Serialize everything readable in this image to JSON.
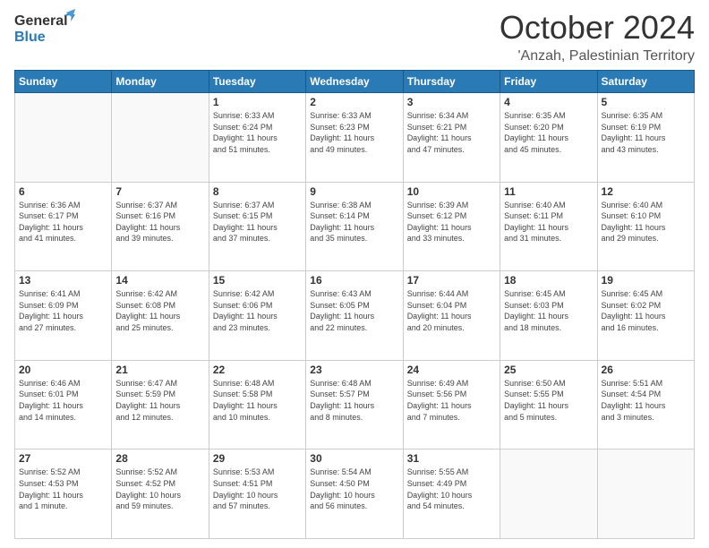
{
  "header": {
    "logo": {
      "general": "General",
      "blue": "Blue"
    },
    "month": "October 2024",
    "location": "'Anzah, Palestinian Territory"
  },
  "weekdays": [
    "Sunday",
    "Monday",
    "Tuesday",
    "Wednesday",
    "Thursday",
    "Friday",
    "Saturday"
  ],
  "weeks": [
    [
      {
        "day": "",
        "info": ""
      },
      {
        "day": "",
        "info": ""
      },
      {
        "day": "1",
        "info": "Sunrise: 6:33 AM\nSunset: 6:24 PM\nDaylight: 11 hours\nand 51 minutes."
      },
      {
        "day": "2",
        "info": "Sunrise: 6:33 AM\nSunset: 6:23 PM\nDaylight: 11 hours\nand 49 minutes."
      },
      {
        "day": "3",
        "info": "Sunrise: 6:34 AM\nSunset: 6:21 PM\nDaylight: 11 hours\nand 47 minutes."
      },
      {
        "day": "4",
        "info": "Sunrise: 6:35 AM\nSunset: 6:20 PM\nDaylight: 11 hours\nand 45 minutes."
      },
      {
        "day": "5",
        "info": "Sunrise: 6:35 AM\nSunset: 6:19 PM\nDaylight: 11 hours\nand 43 minutes."
      }
    ],
    [
      {
        "day": "6",
        "info": "Sunrise: 6:36 AM\nSunset: 6:17 PM\nDaylight: 11 hours\nand 41 minutes."
      },
      {
        "day": "7",
        "info": "Sunrise: 6:37 AM\nSunset: 6:16 PM\nDaylight: 11 hours\nand 39 minutes."
      },
      {
        "day": "8",
        "info": "Sunrise: 6:37 AM\nSunset: 6:15 PM\nDaylight: 11 hours\nand 37 minutes."
      },
      {
        "day": "9",
        "info": "Sunrise: 6:38 AM\nSunset: 6:14 PM\nDaylight: 11 hours\nand 35 minutes."
      },
      {
        "day": "10",
        "info": "Sunrise: 6:39 AM\nSunset: 6:12 PM\nDaylight: 11 hours\nand 33 minutes."
      },
      {
        "day": "11",
        "info": "Sunrise: 6:40 AM\nSunset: 6:11 PM\nDaylight: 11 hours\nand 31 minutes."
      },
      {
        "day": "12",
        "info": "Sunrise: 6:40 AM\nSunset: 6:10 PM\nDaylight: 11 hours\nand 29 minutes."
      }
    ],
    [
      {
        "day": "13",
        "info": "Sunrise: 6:41 AM\nSunset: 6:09 PM\nDaylight: 11 hours\nand 27 minutes."
      },
      {
        "day": "14",
        "info": "Sunrise: 6:42 AM\nSunset: 6:08 PM\nDaylight: 11 hours\nand 25 minutes."
      },
      {
        "day": "15",
        "info": "Sunrise: 6:42 AM\nSunset: 6:06 PM\nDaylight: 11 hours\nand 23 minutes."
      },
      {
        "day": "16",
        "info": "Sunrise: 6:43 AM\nSunset: 6:05 PM\nDaylight: 11 hours\nand 22 minutes."
      },
      {
        "day": "17",
        "info": "Sunrise: 6:44 AM\nSunset: 6:04 PM\nDaylight: 11 hours\nand 20 minutes."
      },
      {
        "day": "18",
        "info": "Sunrise: 6:45 AM\nSunset: 6:03 PM\nDaylight: 11 hours\nand 18 minutes."
      },
      {
        "day": "19",
        "info": "Sunrise: 6:45 AM\nSunset: 6:02 PM\nDaylight: 11 hours\nand 16 minutes."
      }
    ],
    [
      {
        "day": "20",
        "info": "Sunrise: 6:46 AM\nSunset: 6:01 PM\nDaylight: 11 hours\nand 14 minutes."
      },
      {
        "day": "21",
        "info": "Sunrise: 6:47 AM\nSunset: 5:59 PM\nDaylight: 11 hours\nand 12 minutes."
      },
      {
        "day": "22",
        "info": "Sunrise: 6:48 AM\nSunset: 5:58 PM\nDaylight: 11 hours\nand 10 minutes."
      },
      {
        "day": "23",
        "info": "Sunrise: 6:48 AM\nSunset: 5:57 PM\nDaylight: 11 hours\nand 8 minutes."
      },
      {
        "day": "24",
        "info": "Sunrise: 6:49 AM\nSunset: 5:56 PM\nDaylight: 11 hours\nand 7 minutes."
      },
      {
        "day": "25",
        "info": "Sunrise: 6:50 AM\nSunset: 5:55 PM\nDaylight: 11 hours\nand 5 minutes."
      },
      {
        "day": "26",
        "info": "Sunrise: 5:51 AM\nSunset: 4:54 PM\nDaylight: 11 hours\nand 3 minutes."
      }
    ],
    [
      {
        "day": "27",
        "info": "Sunrise: 5:52 AM\nSunset: 4:53 PM\nDaylight: 11 hours\nand 1 minute."
      },
      {
        "day": "28",
        "info": "Sunrise: 5:52 AM\nSunset: 4:52 PM\nDaylight: 10 hours\nand 59 minutes."
      },
      {
        "day": "29",
        "info": "Sunrise: 5:53 AM\nSunset: 4:51 PM\nDaylight: 10 hours\nand 57 minutes."
      },
      {
        "day": "30",
        "info": "Sunrise: 5:54 AM\nSunset: 4:50 PM\nDaylight: 10 hours\nand 56 minutes."
      },
      {
        "day": "31",
        "info": "Sunrise: 5:55 AM\nSunset: 4:49 PM\nDaylight: 10 hours\nand 54 minutes."
      },
      {
        "day": "",
        "info": ""
      },
      {
        "day": "",
        "info": ""
      }
    ]
  ]
}
